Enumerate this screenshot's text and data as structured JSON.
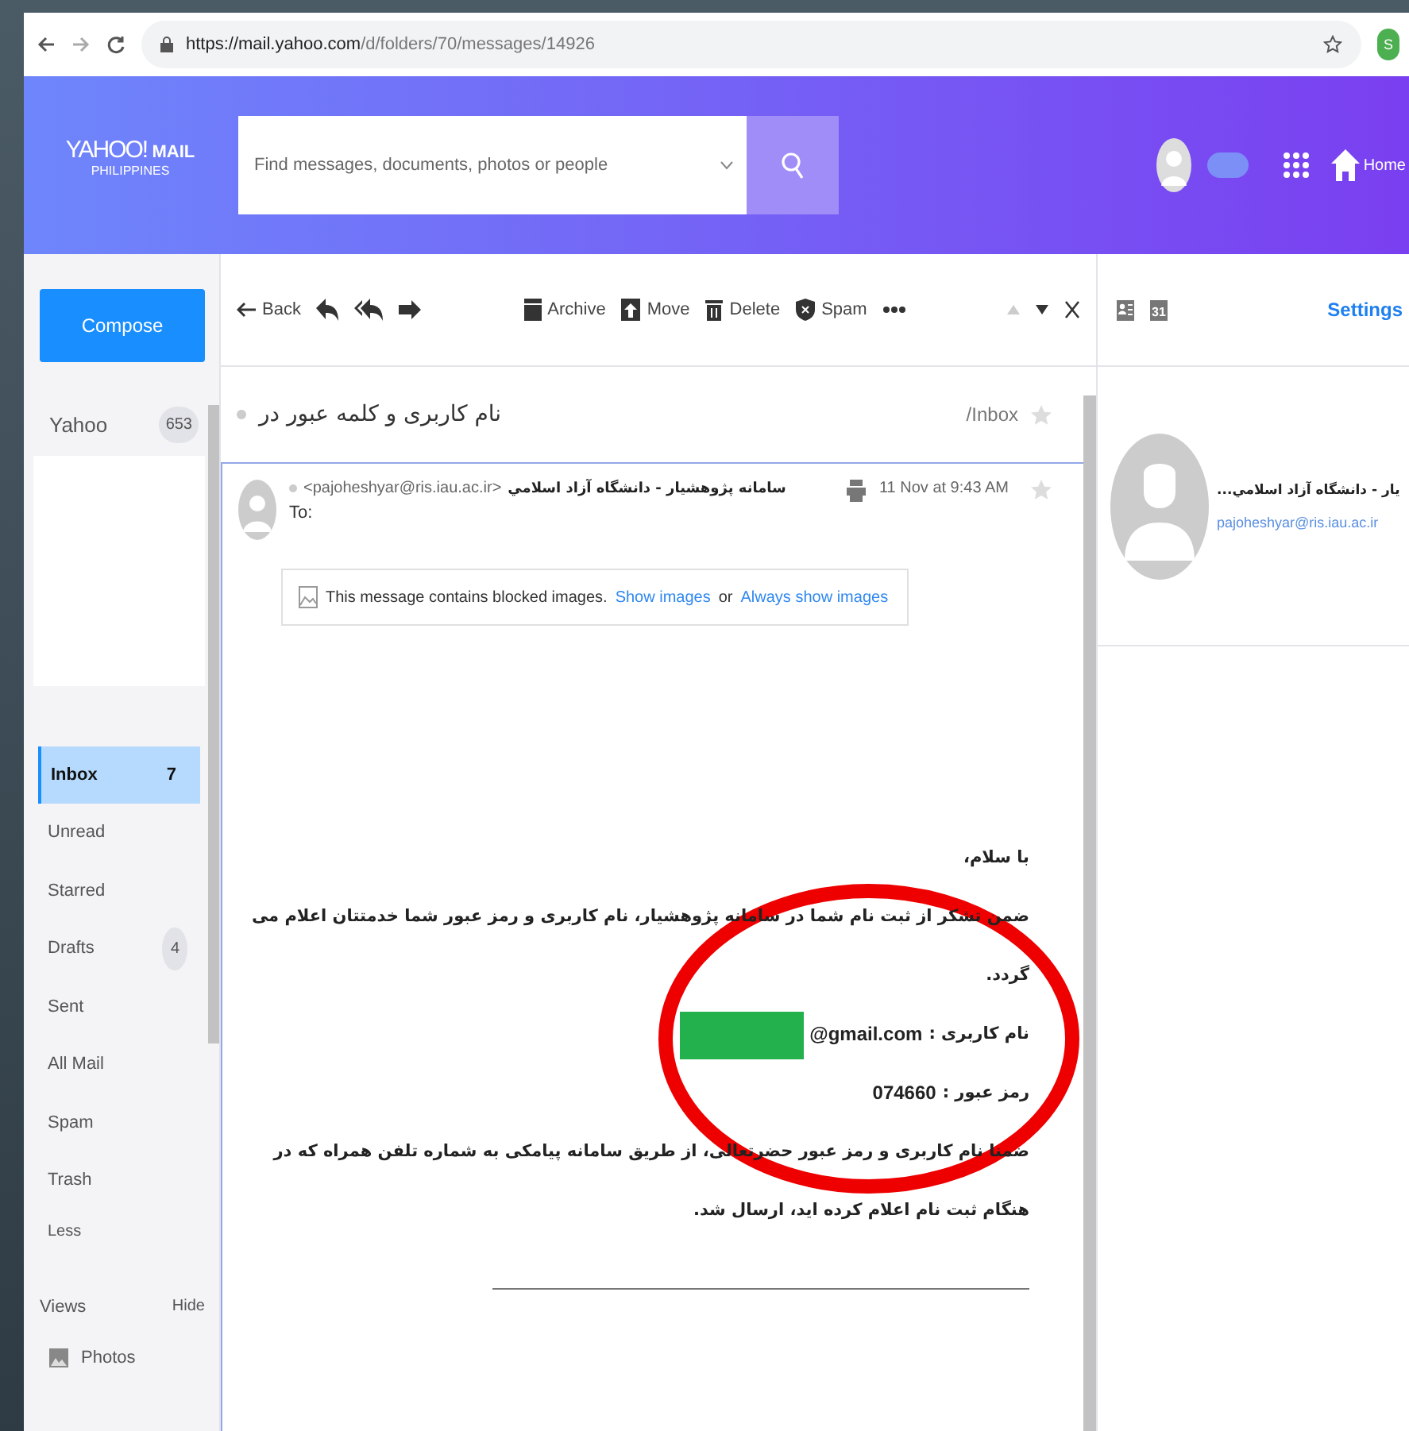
{
  "browser": {
    "url_host": "https://mail.yahoo.com",
    "url_path": "/d/folders/70/messages/14926",
    "profile_initial": "S"
  },
  "header": {
    "logo": "YAHOO!",
    "logo_suffix": "MAIL",
    "region": "PHILIPPINES",
    "search_placeholder": "Find messages, documents, photos or people",
    "home": "Home"
  },
  "sidebar": {
    "compose": "Compose",
    "account": {
      "name": "Yahoo",
      "count": "653"
    },
    "folders": [
      {
        "label": "Inbox",
        "count": "7",
        "selected": true
      },
      {
        "label": "Unread",
        "selected": false
      },
      {
        "label": "Starred",
        "selected": false
      },
      {
        "label": "Drafts",
        "count": "4",
        "selected": false
      },
      {
        "label": "Sent",
        "selected": false
      },
      {
        "label": "All Mail",
        "selected": false
      },
      {
        "label": "Spam",
        "selected": false
      },
      {
        "label": "Trash",
        "selected": false
      }
    ],
    "less": "Less",
    "views": {
      "title": "Views",
      "toggle": "Hide",
      "items": [
        {
          "label": "Photos"
        }
      ]
    }
  },
  "toolbar": {
    "back": "Back",
    "actions": [
      {
        "kind": "archive",
        "label": "Archive"
      },
      {
        "kind": "move",
        "label": "Move"
      },
      {
        "kind": "delete",
        "label": "Delete"
      },
      {
        "kind": "spam",
        "label": "Spam"
      }
    ]
  },
  "message": {
    "subject": "نام کاربری و کلمه عبور در",
    "folder": "/Inbox",
    "sender_name": "سامانه پژوهشيار - دانشگاه آزاد اسلامي",
    "sender_email": "<pajoheshyar@ris.iau.ac.ir>",
    "to": "To:",
    "date": "11 Nov at 9:43 AM",
    "blocked": {
      "text": "This message contains blocked images.",
      "show": "Show images",
      "or": "or",
      "always": "Always show images"
    },
    "body": [
      {
        "kind": "text",
        "text": "با سلام،"
      },
      {
        "kind": "text",
        "text": "ضمن تشکر از ثبت نام شما در سامانه پژوهشیار، نام کاربری و رمز عبور شما خدمتتان اعلام می گردد."
      },
      {
        "kind": "field",
        "label": "نام کاربری :",
        "value": "@gmail.com",
        "redacted": true
      },
      {
        "kind": "field",
        "label": "رمز عبور :",
        "value": "074660",
        "redacted": false
      },
      {
        "kind": "text",
        "text": "ضمنا نام کاربری و رمز عبور حضرتعالی، از طریق سامانه پیامکی به شماره تلفن همراه که در هنگام ثبت نام اعلام کرده اید، ارسال شد."
      }
    ],
    "annotation": {
      "kind": "ellipse",
      "color": "#ee0000"
    }
  },
  "right_pane": {
    "calendar_day": "31",
    "settings": "Settings",
    "contact_name": "...يار - دانشگاه آزاد اسلامي",
    "contact_email": "pajoheshyar@ris.iau.ac.ir"
  }
}
